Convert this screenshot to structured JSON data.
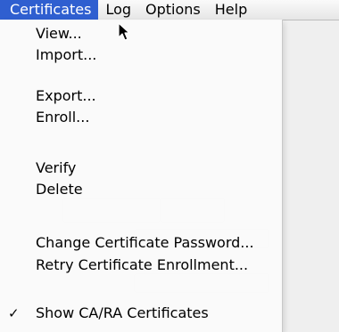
{
  "menubar": {
    "items": [
      {
        "label": "Certificates",
        "active": true
      },
      {
        "label": "Log",
        "active": false
      },
      {
        "label": "Options",
        "active": false
      },
      {
        "label": "Help",
        "active": false
      }
    ]
  },
  "certificates_menu": {
    "items": [
      {
        "label": "View...",
        "checked": false
      },
      {
        "label": "Import...",
        "checked": false
      },
      {
        "label": "Export...",
        "checked": false
      },
      {
        "label": "Enroll...",
        "checked": false
      },
      {
        "label": "Verify",
        "checked": false
      },
      {
        "label": "Delete",
        "checked": false
      },
      {
        "label": "Change Certificate Password...",
        "checked": false
      },
      {
        "label": "Retry Certificate Enrollment...",
        "checked": false
      },
      {
        "label": "Show CA/RA Certificates",
        "checked": true
      }
    ]
  },
  "colors": {
    "highlight": "#2f5fd0",
    "menu_background": "#fafafa"
  },
  "icons": {
    "checkmark": "checkmark-icon",
    "cursor": "mouse-pointer-icon"
  }
}
